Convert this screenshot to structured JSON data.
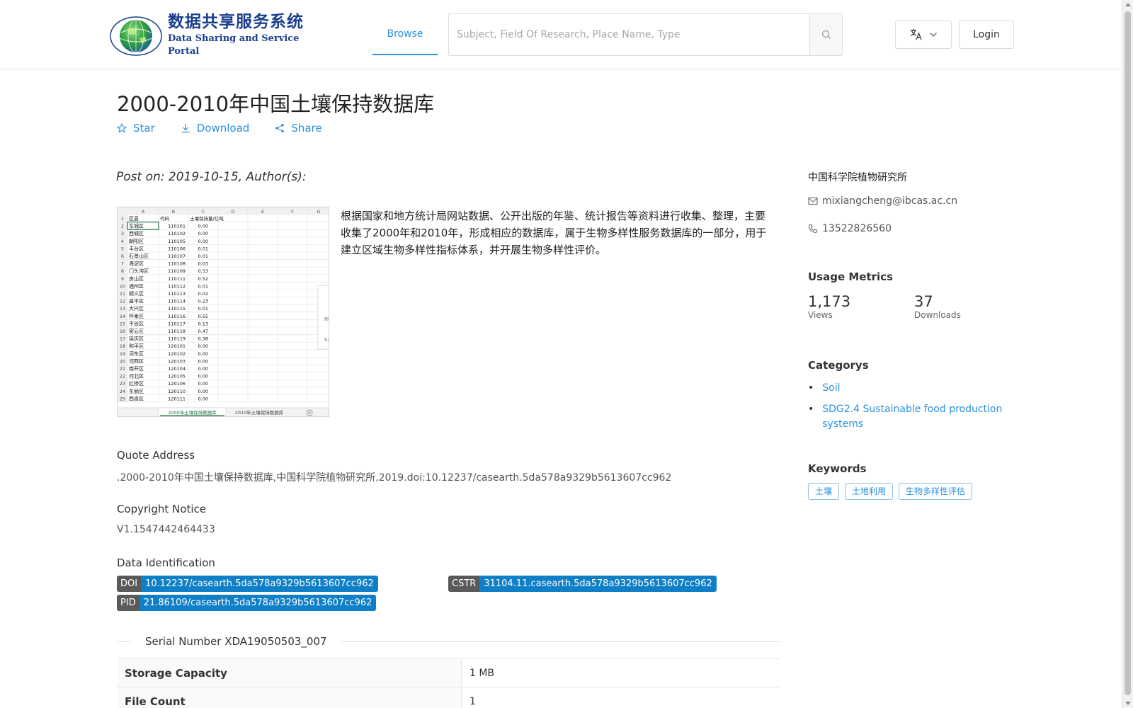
{
  "header": {
    "logo_cn": "数据共享服务系统",
    "logo_en": "Data Sharing and Service Portal",
    "logo_ring_text": "地球大数据科学数据中心",
    "logo_ring_en": "Big Earth Data Center,CAS",
    "nav_browse": "Browse",
    "search_placeholder": "Subject, Field Of Research, Place Name, Type",
    "login": "Login"
  },
  "dataset": {
    "title": "2000-2010年中国土壤保持数据库",
    "actions": {
      "star": "Star",
      "download": "Download",
      "share": "Share"
    },
    "post_on": "Post on: 2019-10-15, Author(s):",
    "description": "根据国家和地方统计局网站数据、公开出版的年鉴、统计报告等资料进行收集、整理，主要收集了2000年和2010年，形成相应的数据库，属于生物多样性服务数据库的一部分，用于建立区域生物多样性指标体系，并开展生物多样性评价。",
    "quote_label": "Quote Address",
    "quote_value": ".2000-2010年中国土壤保持数据库,中国科学院植物研究所,2019.doi:10.12237/casearth.5da578a9329b5613607cc962",
    "copyright_label": "Copyright Notice",
    "copyright_value": "V1.1547442464433",
    "ident_label": "Data Identification",
    "doi_key": "DOI",
    "doi_value": "10.12237/casearth.5da578a9329b5613607cc962",
    "cstr_key": "CSTR",
    "cstr_value": "31104.11.casearth.5da578a9329b5613607cc962",
    "pid_key": "PID",
    "pid_value": "21.86109/casearth.5da578a9329b5613607cc962",
    "serial": "Serial Number XDA19050503_007",
    "table": [
      {
        "key": "Storage Capacity",
        "value": "1 MB"
      },
      {
        "key": "File Count",
        "value": "1"
      }
    ]
  },
  "thumbnail": {
    "col_headers": [
      "A",
      "B",
      "C",
      "D",
      "E",
      "F",
      "G"
    ],
    "header_row": [
      "区县",
      "代码",
      "土壤保持量/亿吨"
    ],
    "rows": [
      [
        "东城区",
        "110101",
        "0.00"
      ],
      [
        "西城区",
        "110102",
        "0.00"
      ],
      [
        "朝阳区",
        "110105",
        "0.00"
      ],
      [
        "丰台区",
        "110106",
        "0.01"
      ],
      [
        "石景山区",
        "110107",
        "0.01"
      ],
      [
        "海淀区",
        "110108",
        "0.03"
      ],
      [
        "门头沟区",
        "110109",
        "0.53"
      ],
      [
        "房山区",
        "110111",
        "0.52"
      ],
      [
        "通州区",
        "110112",
        "0.01"
      ],
      [
        "顺义区",
        "110113",
        "0.02"
      ],
      [
        "昌平区",
        "110114",
        "0.23"
      ],
      [
        "大兴区",
        "110115",
        "0.01"
      ],
      [
        "怀柔区",
        "110116",
        "0.55"
      ],
      [
        "平谷区",
        "110117",
        "0.13"
      ],
      [
        "密云区",
        "110118",
        "0.47"
      ],
      [
        "延庆区",
        "110119",
        "0.38"
      ],
      [
        "和平区",
        "120101",
        "0.00"
      ],
      [
        "河东区",
        "120102",
        "0.00"
      ],
      [
        "河西区",
        "120103",
        "0.00"
      ],
      [
        "南开区",
        "120104",
        "0.00"
      ],
      [
        "河北区",
        "120105",
        "0.00"
      ],
      [
        "红桥区",
        "120106",
        "0.00"
      ],
      [
        "东丽区",
        "120110",
        "0.00"
      ],
      [
        "西青区",
        "120111",
        "0.00"
      ]
    ],
    "side_fragments": [
      "fill",
      "52"
    ],
    "sheet_tabs": [
      "2000年土壤保持数据库",
      "2010年土壤保持数据库"
    ]
  },
  "sidebar": {
    "org": "中国科学院植物研究所",
    "email": "mixiangcheng@ibcas.ac.cn",
    "phone": "13522826560",
    "usage_heading": "Usage Metrics",
    "views_value": "1,173",
    "views_label": "Views",
    "downloads_value": "37",
    "downloads_label": "Downloads",
    "categories_heading": "Categorys",
    "categories": [
      "Soil",
      "SDG2.4 Sustainable food production systems"
    ],
    "keywords_heading": "Keywords",
    "keywords": [
      "土壤",
      "土地利用",
      "生物多样性评估"
    ]
  },
  "colors": {
    "accent": "#2b91e2",
    "logo_blue": "#1a3f8e",
    "badge_blue": "#0f7fc7",
    "badge_gray": "#5a5a5a"
  }
}
